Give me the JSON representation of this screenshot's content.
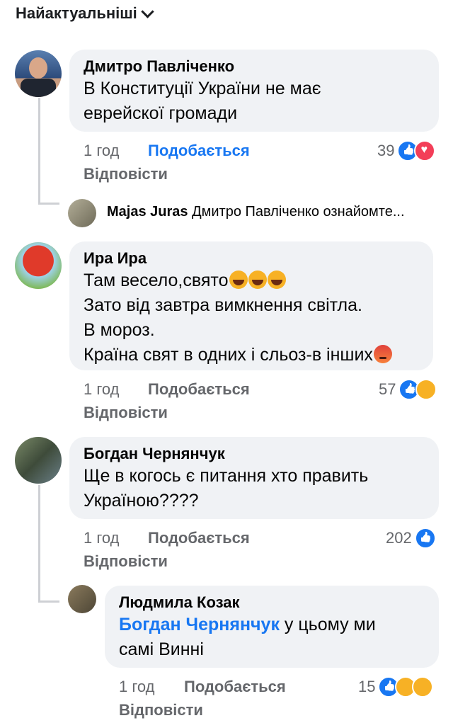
{
  "sort_label": "Найактуальніші",
  "colors": {
    "like_blue": "#1877f2",
    "bubble_bg": "#f0f2f5",
    "meta_gray": "#65676b"
  },
  "comments": [
    {
      "author": "Дмитро Павліченко",
      "text": "В Конституції України не має\nеврейскої громади",
      "time": "1 год",
      "like": "Подобається",
      "reply": "Відповісти",
      "reaction_count": "39",
      "reactions": [
        "like-icon",
        "love-icon"
      ],
      "reply_preview": {
        "author": "Majas Juras",
        "text": "Дмитро Павліченко ознайомте..."
      }
    },
    {
      "author": "Ира Ира",
      "line1": "Там весело,свято",
      "line2": "Зато від завтра вимкнення світла.",
      "line3": "В мороз.",
      "line4": "Країна свят в одних і сльоз-в інших",
      "time": "1 год",
      "like": "Подобається",
      "reply": "Відповісти",
      "reaction_count": "57",
      "reactions": [
        "like-icon",
        "sad-icon"
      ]
    },
    {
      "author": "Богдан Чернянчук",
      "text": "Ще в когось є питання хто править\nУкраїною????",
      "time": "1 год",
      "like": "Подобається",
      "reply": "Відповісти",
      "reaction_count": "202",
      "reactions": [
        "like-icon"
      ]
    },
    {
      "author": "Людмила Козак",
      "mention": "Богдан Чернянчук",
      "text_after": " у цьому ми",
      "text_line2": "самі Винні",
      "time": "1 год",
      "like": "Подобається",
      "reply": "Відповісти",
      "reaction_count": "15",
      "reactions": [
        "like-icon",
        "care-icon",
        "haha-icon"
      ]
    }
  ]
}
